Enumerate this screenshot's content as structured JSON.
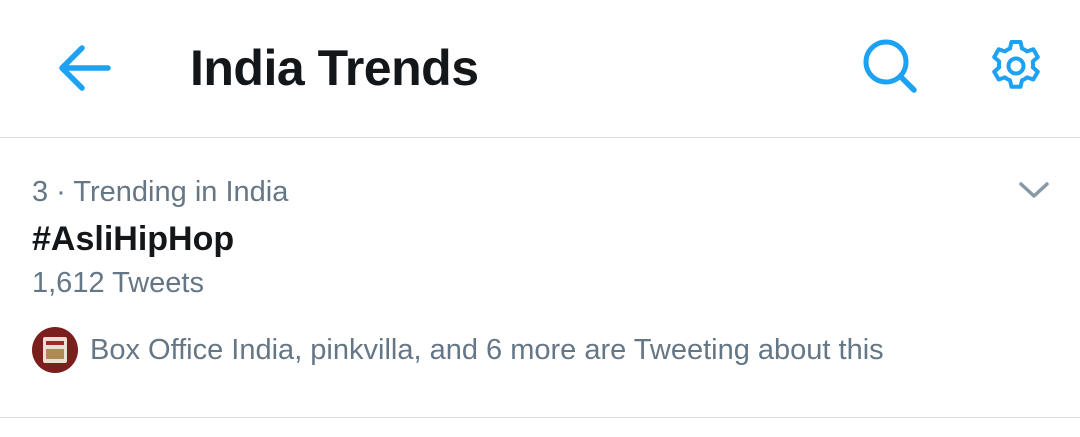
{
  "header": {
    "title": "India Trends",
    "back_icon": "arrow-left-icon",
    "search_icon": "search-icon",
    "settings_icon": "gear-icon"
  },
  "trend": {
    "meta": "3 · Trending in India",
    "name": "#AsliHipHop",
    "count": "1,612 Tweets",
    "context": "Box Office India, pinkvilla, and 6 more are Tweeting about this",
    "menu_icon": "chevron-down-icon"
  },
  "colors": {
    "accent": "#1da1f2",
    "text_primary": "#14171a",
    "text_secondary": "#657786",
    "divider": "#d9dee2"
  }
}
